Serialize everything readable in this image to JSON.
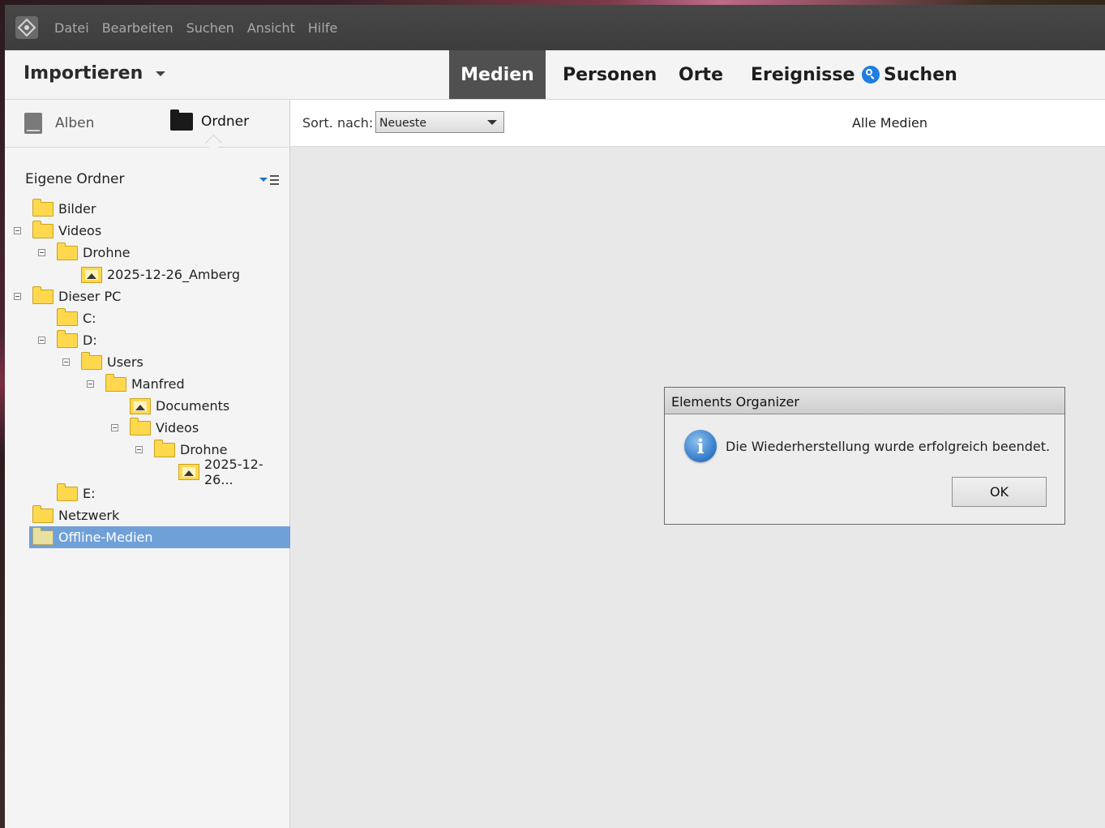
{
  "menubar": {
    "items": [
      "Datei",
      "Bearbeiten",
      "Suchen",
      "Ansicht",
      "Hilfe"
    ]
  },
  "topnav": {
    "import_label": "Importieren",
    "tabs": [
      "Medien",
      "Personen",
      "Orte",
      "Ereignisse"
    ],
    "search_label": "Suchen",
    "active_tab": "Medien"
  },
  "sidebar": {
    "tabs": [
      "Alben",
      "Ordner"
    ],
    "active_tab": "Ordner",
    "section_title": "Eigene Ordner",
    "tree": [
      {
        "label": "Bilder",
        "depth": 0,
        "expander": false,
        "icon": "folder-icon"
      },
      {
        "label": "Videos",
        "depth": 0,
        "expander": true,
        "icon": "folder-icon"
      },
      {
        "label": "Drohne",
        "depth": 1,
        "expander": true,
        "icon": "folder-icon"
      },
      {
        "label": "2025-12-26_Amberg",
        "depth": 2,
        "expander": false,
        "icon": "image-folder-icon"
      },
      {
        "label": "Dieser PC",
        "depth": 0,
        "expander": true,
        "icon": "folder-icon"
      },
      {
        "label": "C:",
        "depth": 1,
        "expander": false,
        "icon": "folder-icon"
      },
      {
        "label": "D:",
        "depth": 1,
        "expander": true,
        "icon": "folder-icon"
      },
      {
        "label": "Users",
        "depth": 2,
        "expander": true,
        "icon": "folder-icon"
      },
      {
        "label": "Manfred",
        "depth": 3,
        "expander": true,
        "icon": "folder-icon"
      },
      {
        "label": "Documents",
        "depth": 4,
        "expander": false,
        "icon": "image-folder-icon"
      },
      {
        "label": "Videos",
        "depth": 4,
        "expander": true,
        "icon": "folder-icon"
      },
      {
        "label": "Drohne",
        "depth": 5,
        "expander": true,
        "icon": "folder-icon"
      },
      {
        "label": "2025-12-26...",
        "depth": 6,
        "expander": false,
        "icon": "image-folder-icon"
      },
      {
        "label": "E:",
        "depth": 1,
        "expander": false,
        "icon": "folder-icon"
      },
      {
        "label": "Netzwerk",
        "depth": 0,
        "expander": false,
        "icon": "folder-icon"
      },
      {
        "label": "Offline-Medien",
        "depth": 0,
        "expander": false,
        "icon": "folder-icon",
        "selected": true
      }
    ]
  },
  "content": {
    "sort_label": "Sort. nach:",
    "sort_value": "Neueste",
    "filter_label": "Alle Medien"
  },
  "dialog": {
    "title": "Elements Organizer",
    "message": "Die Wiederherstellung wurde erfolgreich beendet.",
    "ok_label": "OK",
    "icon": "info-icon"
  },
  "colors": {
    "accent": "#1f7fe0",
    "selection": "#6fa0d8",
    "active_tab_bg": "#505050"
  }
}
